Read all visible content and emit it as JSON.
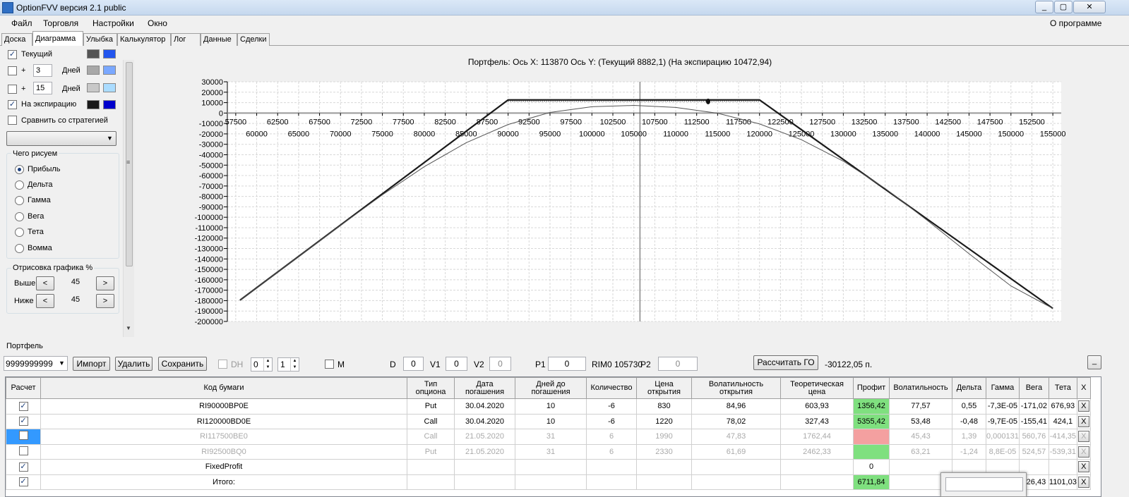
{
  "window": {
    "title": "OptionFVV версия 2.1 public",
    "buttons": [
      "_",
      "▢",
      "✕"
    ]
  },
  "menu": {
    "items": [
      "Файл",
      "Торговля",
      "Настройки",
      "Окно"
    ],
    "about": "О программе"
  },
  "tabs": [
    "Доска",
    "Диаграмма",
    "Улыбка",
    "Калькулятор",
    "Лог",
    "Данные",
    "Сделки"
  ],
  "active_tab": "Диаграмма",
  "left_panel": {
    "current": {
      "label": "Текущий",
      "checked": true,
      "colors": [
        "#555555",
        "#2255ee"
      ]
    },
    "plus1": {
      "label": "+",
      "days": "3",
      "days_label": "Дней",
      "checked": false,
      "colors": [
        "#a8a8a8",
        "#7aa8ff"
      ]
    },
    "plus2": {
      "label": "+",
      "days": "15",
      "days_label": "Дней",
      "checked": false,
      "colors": [
        "#c8c8c8",
        "#aadcff"
      ]
    },
    "expiry": {
      "label": "На экспирацию",
      "checked": true,
      "colors": [
        "#1a1a1a",
        "#0000cc"
      ]
    },
    "compare": {
      "label": "Сравнить со стратегией",
      "checked": false
    },
    "draw_group": {
      "title": "Чего рисуем",
      "options": [
        "Прибыль",
        "Дельта",
        "Гамма",
        "Вега",
        "Тета",
        "Вомма"
      ],
      "selected": "Прибыль"
    },
    "render_group": {
      "title": "Отрисовка графика %",
      "above_label": "Выше",
      "above_value": "45",
      "below_label": "Ниже",
      "below_value": "45",
      "dec": "<",
      "inc": ">"
    }
  },
  "chart_data": {
    "type": "line",
    "title": "Портфель: Ось X: 113870 Ось Y:  (Текущий 8882,1)  (На экспирацию 10472,94)",
    "xlim": [
      56500,
      156000
    ],
    "ylim": [
      -200000,
      30000
    ],
    "x_ticks_top": [
      "57500",
      "62500",
      "67500",
      "72500",
      "77500",
      "82500",
      "87500",
      "92500",
      "97500",
      "102500",
      "107500",
      "112500",
      "117500",
      "122500",
      "127500",
      "132500",
      "137500",
      "142500",
      "147500",
      "152500"
    ],
    "x_ticks_bottom": [
      "60000",
      "65000",
      "70000",
      "75000",
      "80000",
      "85000",
      "90000",
      "95000",
      "100000",
      "105000",
      "110000",
      "115000",
      "120000",
      "125000",
      "130000",
      "135000",
      "140000",
      "145000",
      "150000",
      "155000"
    ],
    "y_ticks": [
      "30000",
      "20000",
      "10000",
      "0",
      "-10000",
      "-20000",
      "-30000",
      "-40000",
      "-50000",
      "-60000",
      "-70000",
      "-80000",
      "-90000",
      "-100000",
      "-110000",
      "-120000",
      "-130000",
      "-140000",
      "-150000",
      "-160000",
      "-170000",
      "-180000",
      "-190000",
      "-200000"
    ],
    "cursor_x": 105730,
    "marker": {
      "x": 113870,
      "y": 10472.94
    },
    "grid": true,
    "series": [
      {
        "color": "#1a1a1a",
        "x": [
          58000,
          90000,
          120000,
          155000
        ],
        "y": [
          -179600,
          12600,
          12600,
          -187500
        ]
      },
      {
        "color": "#555555",
        "x": [
          58000,
          65000,
          70000,
          75000,
          80000,
          85000,
          90000,
          95000,
          100000,
          105000,
          110000,
          115000,
          120000,
          125000,
          130000,
          135000,
          140000,
          145000,
          150000,
          155000
        ],
        "y": [
          -179600,
          -137600,
          -107800,
          -78500,
          -51500,
          -28500,
          -11000,
          600,
          6100,
          7300,
          5400,
          -200,
          -10400,
          -25600,
          -46200,
          -72400,
          -102900,
          -135000,
          -165900,
          -187500
        ]
      }
    ]
  },
  "portfolio_bar": {
    "group_label": "Портфель",
    "account": "9999999999",
    "import": "Импорт",
    "delete": "Удалить",
    "save": "Сохранить",
    "dh_label": "DH",
    "spin1": "0",
    "spin2": "1",
    "m_label": "M",
    "d_label": "D",
    "d_value": "0",
    "v1_label": "V1",
    "v1_value": "0",
    "v2_label": "V2",
    "v2_value": "0",
    "p1_label": "P1",
    "p1_value": "0",
    "rim_label": "RIM0 105730",
    "p2_label": "P2",
    "p2_value": "0",
    "calc_button": "Рассчитать ГО",
    "go_value": "-30122,05 п.",
    "min_button": "_"
  },
  "table": {
    "headers": [
      "Расчет",
      "Код бумаги",
      "Тип опциона",
      "Дата погашения",
      "Дней до погашения",
      "Количество",
      "Цена открытия",
      "Волатильность открытия",
      "Теоретическая цена",
      "Профит",
      "Волатильность",
      "Дельта",
      "Гамма",
      "Вега",
      "Тета",
      "X"
    ],
    "rows": [
      {
        "checked": true,
        "code": "RI90000BP0E",
        "type": "Put",
        "date": "30.04.2020",
        "days": "10",
        "qty": "-6",
        "open": "830",
        "vol_open": "84,96",
        "theo": "603,93",
        "profit": "1356,42",
        "vol": "77,57",
        "delta": "0,55",
        "gamma": "-7,3E-05",
        "vega": "-171,02",
        "theta": "676,93",
        "x": "X"
      },
      {
        "checked": true,
        "code": "RI120000BD0E",
        "type": "Call",
        "date": "30.04.2020",
        "days": "10",
        "qty": "-6",
        "open": "1220",
        "vol_open": "78,02",
        "theo": "327,43",
        "profit": "5355,42",
        "vol": "53,48",
        "delta": "-0,48",
        "gamma": "-9,7E-05",
        "vega": "-155,41",
        "theta": "424,1",
        "x": "X"
      },
      {
        "checked": false,
        "code": "RI117500BE0",
        "type": "Call",
        "date": "21.05.2020",
        "days": "31",
        "qty": "6",
        "open": "1990",
        "vol_open": "47,83",
        "theo": "1762,44",
        "profit": "",
        "vol": "45,43",
        "delta": "1,39",
        "gamma": "0,000131",
        "vega": "560,76",
        "theta": "-414,35",
        "x": "X"
      },
      {
        "checked": false,
        "code": "RI92500BQ0",
        "type": "Put",
        "date": "21.05.2020",
        "days": "31",
        "qty": "6",
        "open": "2330",
        "vol_open": "61,69",
        "theo": "2462,33",
        "profit": "",
        "vol": "63,21",
        "delta": "-1,24",
        "gamma": "8,8E-05",
        "vega": "524,57",
        "theta": "-539,31",
        "x": "X"
      },
      {
        "checked": true,
        "code": "FixedProfit",
        "type": "",
        "date": "",
        "days": "",
        "qty": "",
        "open": "",
        "vol_open": "",
        "theo": "",
        "profit": "0",
        "vol": "",
        "delta": "",
        "gamma": "",
        "vega": "",
        "theta": "",
        "x": "X"
      },
      {
        "checked": true,
        "code": "Итого:",
        "type": "",
        "date": "",
        "days": "",
        "qty": "",
        "open": "",
        "vol_open": "",
        "theo": "",
        "profit": "6711,84",
        "vol": "",
        "delta": "",
        "gamma": "",
        "vega": "826,43",
        "theta": "1101,03",
        "x": "X"
      }
    ]
  }
}
